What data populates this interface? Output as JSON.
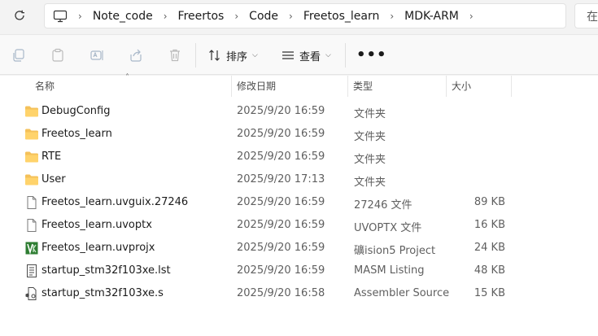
{
  "breadcrumb": [
    "Note_code",
    "Freertos",
    "Code",
    "Freetos_learn",
    "MDK-ARM"
  ],
  "search_partial": "在",
  "toolbar": {
    "sort_label": "排序",
    "view_label": "查看",
    "more_label": "•••"
  },
  "columns": {
    "name": "名称",
    "date": "修改日期",
    "type": "类型",
    "size": "大小"
  },
  "files": [
    {
      "name": "DebugConfig",
      "date": "2025/9/20 16:59",
      "type": "文件夹",
      "size": "",
      "icon": "folder-icon"
    },
    {
      "name": "Freetos_learn",
      "date": "2025/9/20 16:59",
      "type": "文件夹",
      "size": "",
      "icon": "folder-icon"
    },
    {
      "name": "RTE",
      "date": "2025/9/20 16:59",
      "type": "文件夹",
      "size": "",
      "icon": "folder-icon"
    },
    {
      "name": "User",
      "date": "2025/9/20 17:13",
      "type": "文件夹",
      "size": "",
      "icon": "folder-icon"
    },
    {
      "name": "Freetos_learn.uvguix.27246",
      "date": "2025/9/20 16:59",
      "type": "27246 文件",
      "size": "89 KB",
      "icon": "file-icon"
    },
    {
      "name": "Freetos_learn.uvoptx",
      "date": "2025/9/20 16:59",
      "type": "UVOPTX 文件",
      "size": "16 KB",
      "icon": "file-icon"
    },
    {
      "name": "Freetos_learn.uvprojx",
      "date": "2025/9/20 16:59",
      "type": "礦ision5 Project",
      "size": "24 KB",
      "icon": "keil-project-icon"
    },
    {
      "name": "startup_stm32f103xe.lst",
      "date": "2025/9/20 16:59",
      "type": "MASM Listing",
      "size": "48 KB",
      "icon": "text-file-icon"
    },
    {
      "name": "startup_stm32f103xe.s",
      "date": "2025/9/20 16:58",
      "type": "Assembler Source",
      "size": "15 KB",
      "icon": "asm-file-icon"
    }
  ]
}
